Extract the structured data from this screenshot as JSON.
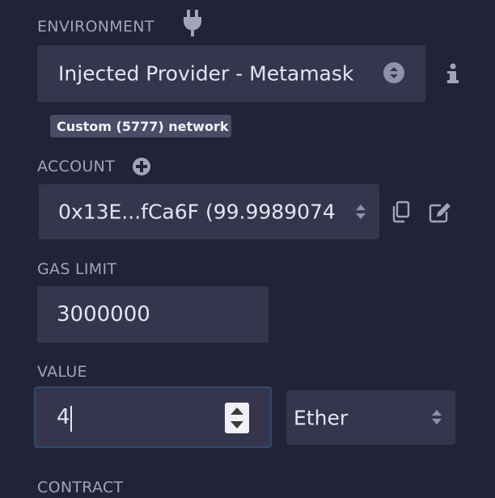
{
  "environment": {
    "label": "ENVIRONMENT",
    "provider": "Injected Provider - Metamask",
    "network_badge": "Custom (5777) network"
  },
  "account": {
    "label": "ACCOUNT",
    "value": "0x13E...fCa6F (99.9989074"
  },
  "gas_limit": {
    "label": "GAS LIMIT",
    "value": "3000000"
  },
  "value_field": {
    "label": "VALUE",
    "amount": "4",
    "unit": "Ether"
  },
  "contract": {
    "label": "CONTRACT"
  },
  "colors": {
    "background": "#222336",
    "field": "#35364d",
    "focus_border": "#2f4b6e",
    "text": "#e4e5f1",
    "label": "#a2a3bd"
  },
  "icons": [
    "plug-icon",
    "info-icon",
    "plus-circle-icon",
    "copy-icon",
    "edit-icon",
    "chevron-updown-icon"
  ]
}
